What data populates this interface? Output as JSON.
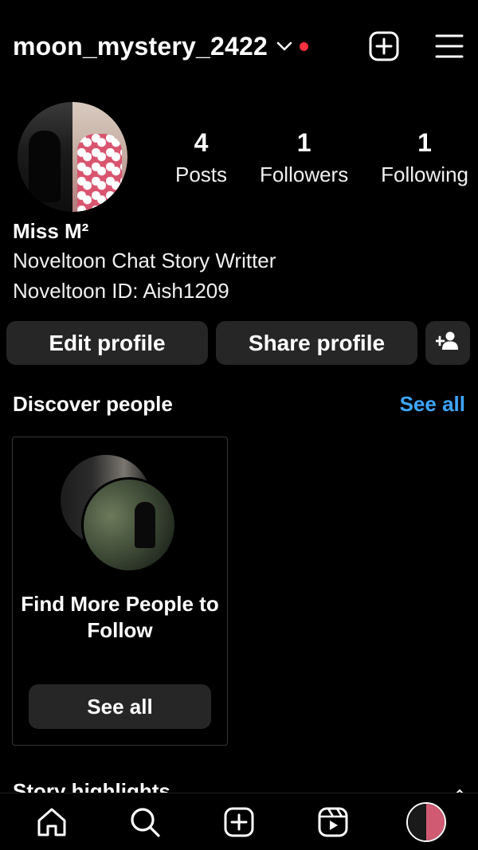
{
  "header": {
    "username": "moon_mystery_2422",
    "dropdown_icon": "chevron-down-icon",
    "notification_color": "#ff3040",
    "create_icon": "plus-square-icon",
    "menu_icon": "hamburger-menu-icon"
  },
  "profile": {
    "stats": [
      {
        "value": "4",
        "label": "Posts"
      },
      {
        "value": "1",
        "label": "Followers"
      },
      {
        "value": "1",
        "label": "Following"
      }
    ],
    "name": "Miss M²",
    "bio_line_1": "Noveltoon Chat Story Writter",
    "bio_line_2": "Noveltoon ID: Aish1209"
  },
  "actions": {
    "edit_profile": "Edit profile",
    "share_profile": "Share profile",
    "add_person_icon": "add-person-icon"
  },
  "discover": {
    "title": "Discover people",
    "see_all": "See all",
    "see_all_color": "#3ea6ff",
    "card_text": "Find More People to Follow",
    "card_button": "See all"
  },
  "highlights": {
    "title": "Story highlights"
  },
  "bottom_nav": [
    {
      "icon": "home-icon"
    },
    {
      "icon": "search-icon"
    },
    {
      "icon": "create-icon"
    },
    {
      "icon": "reels-icon"
    },
    {
      "icon": "profile-avatar"
    }
  ],
  "colors": {
    "background": "#000000",
    "button_bg": "#262626",
    "accent": "#3ea6ff"
  }
}
